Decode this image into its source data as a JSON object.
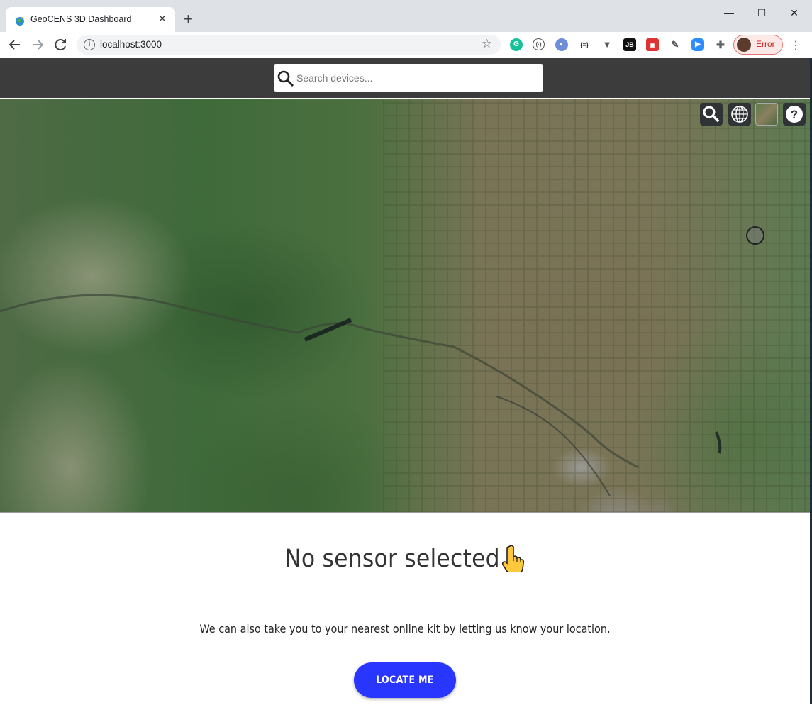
{
  "browser": {
    "tab_title": "GeoCENS 3D Dashboard",
    "url": "localhost:3000",
    "profile_label": "Error",
    "tab_close": "✕",
    "new_tab": "+",
    "window_controls": {
      "minimize": "—",
      "maximize": "☐",
      "close": "✕"
    },
    "menu": "⋮"
  },
  "header": {
    "search_placeholder": "Search devices..."
  },
  "map": {
    "controls": [
      "search-icon",
      "globe-icon",
      "basemap-picker",
      "help-icon"
    ],
    "help_glyph": "?"
  },
  "panel": {
    "title": "No sensor selected",
    "locate_text": "We can also take you to your nearest online kit by letting us know your location.",
    "locate_button": "LOCATE ME",
    "accent_color": "#2836ff"
  }
}
